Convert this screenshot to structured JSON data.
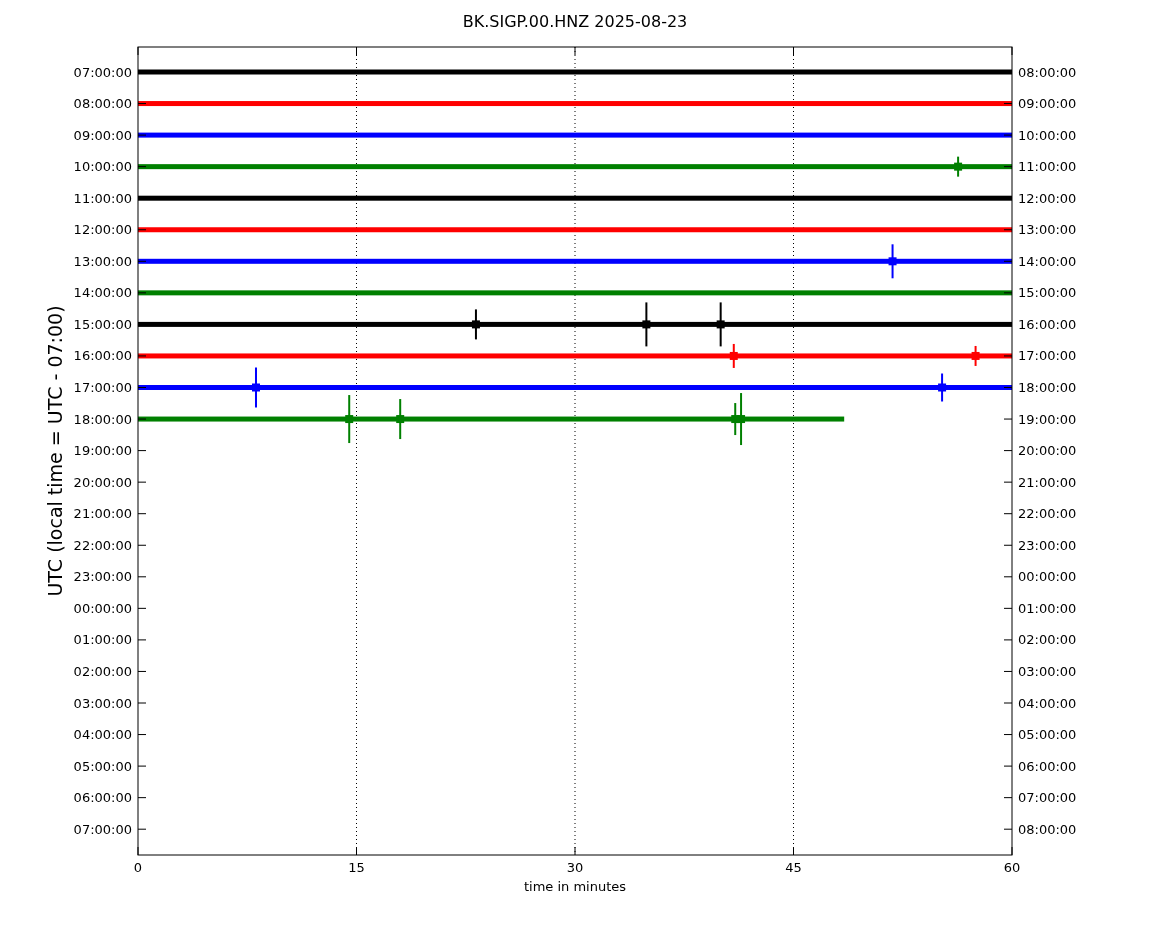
{
  "title": "BK.SIGP.00.HNZ 2025-08-23",
  "ylabel": "UTC (local time = UTC - 07:00)",
  "xlabel": "time in minutes",
  "xticks": [
    "0",
    "15",
    "30",
    "45",
    "60"
  ],
  "left_labels": [
    "07:00:00",
    "08:00:00",
    "09:00:00",
    "10:00:00",
    "11:00:00",
    "12:00:00",
    "13:00:00",
    "14:00:00",
    "15:00:00",
    "16:00:00",
    "17:00:00",
    "18:00:00",
    "19:00:00",
    "20:00:00",
    "21:00:00",
    "22:00:00",
    "23:00:00",
    "00:00:00",
    "01:00:00",
    "02:00:00",
    "03:00:00",
    "04:00:00",
    "05:00:00",
    "06:00:00",
    "07:00:00"
  ],
  "right_labels": [
    "08:00:00",
    "09:00:00",
    "10:00:00",
    "11:00:00",
    "12:00:00",
    "13:00:00",
    "14:00:00",
    "15:00:00",
    "16:00:00",
    "17:00:00",
    "18:00:00",
    "19:00:00",
    "20:00:00",
    "21:00:00",
    "22:00:00",
    "23:00:00",
    "00:00:00",
    "01:00:00",
    "02:00:00",
    "03:00:00",
    "04:00:00",
    "05:00:00",
    "06:00:00",
    "07:00:00",
    "08:00:00"
  ],
  "traces": [
    {
      "color": "#000000",
      "level": 1
    },
    {
      "color": "#ff0000",
      "level": 1
    },
    {
      "color": "#0000ff",
      "level": 1
    },
    {
      "color": "#008000",
      "level": 1
    },
    {
      "color": "#000000",
      "level": 1
    },
    {
      "color": "#ff0000",
      "level": 1
    },
    {
      "color": "#0000ff",
      "level": 1
    },
    {
      "color": "#008000",
      "level": 1
    },
    {
      "color": "#000000",
      "level": 1
    },
    {
      "color": "#ff0000",
      "level": 1
    },
    {
      "color": "#0000ff",
      "level": 1
    },
    {
      "color": "#008000",
      "level": 0.808
    }
  ]
}
